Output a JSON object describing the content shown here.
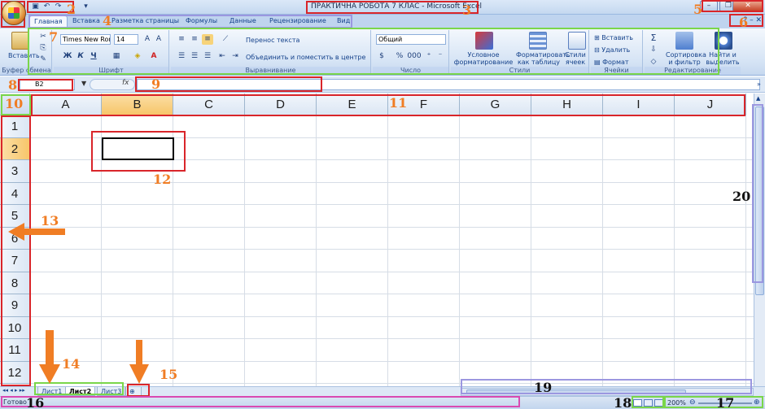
{
  "window": {
    "title": "ПРАКТИЧНА РОБОТА 7 КЛАС - Microsoft Excel"
  },
  "tabs": [
    "Главная",
    "Вставка",
    "Разметка страницы",
    "Формулы",
    "Данные",
    "Рецензирование",
    "Вид"
  ],
  "ribbon": {
    "clipboard": {
      "paste": "Вставить",
      "label": "Буфер обмена"
    },
    "font": {
      "name": "Times New Rom",
      "size": "14",
      "bold": "Ж",
      "italic": "К",
      "underline": "Ч",
      "label": "Шрифт"
    },
    "alignment": {
      "wrap": "Перенос текста",
      "merge": "Объединить и поместить в центре",
      "label": "Выравнивание"
    },
    "number": {
      "format": "Общий",
      "percent": "%",
      "thousands": "000",
      "label": "Число"
    },
    "styles": {
      "conditional": "Условное\nформатирование",
      "as_table": "Форматировать\nкак таблицу",
      "cell_styles": "Стили\nячеек",
      "label": "Стили"
    },
    "cells": {
      "insert": "Вставить",
      "delete": "Удалить",
      "format": "Формат",
      "label": "Ячейки"
    },
    "editing": {
      "sigma": "Σ",
      "sort": "Сортировка\nи фильтр",
      "find": "Найти и\nвыделить",
      "label": "Редактирование"
    }
  },
  "formula_bar": {
    "name_box": "B2",
    "fx": "fx",
    "value": ""
  },
  "grid": {
    "columns": [
      "A",
      "B",
      "C",
      "D",
      "E",
      "F",
      "G",
      "H",
      "I",
      "J"
    ],
    "rows": [
      "1",
      "2",
      "3",
      "4",
      "5",
      "6",
      "7",
      "8",
      "9",
      "10",
      "11",
      "12"
    ],
    "selected_column": "B",
    "selected_row": "2"
  },
  "sheets": [
    "Лист1",
    "Лист2",
    "Лист3"
  ],
  "active_sheet": "Лист2",
  "status": {
    "text": "Готово",
    "zoom": "200%"
  },
  "annotations": {
    "n1": "1",
    "n2": "2",
    "n3": "3",
    "n4": "4",
    "n5": "5",
    "n6": "6",
    "n7": "7",
    "n8": "8",
    "n9": "9",
    "n10": "10",
    "n11": "11",
    "n12": "12",
    "n13": "13",
    "n14": "14",
    "n15": "15",
    "n16": "16",
    "n17": "17",
    "n18": "18",
    "n19": "19",
    "n20": "20"
  },
  "colors": {
    "annotation_red": "#d9252a",
    "annotation_green": "#7ad64a",
    "annotation_orange": "#f07d24",
    "annotation_blue": "#9b97e0",
    "annotation_pink": "#d94ab2",
    "selection": "#f7c66a"
  }
}
